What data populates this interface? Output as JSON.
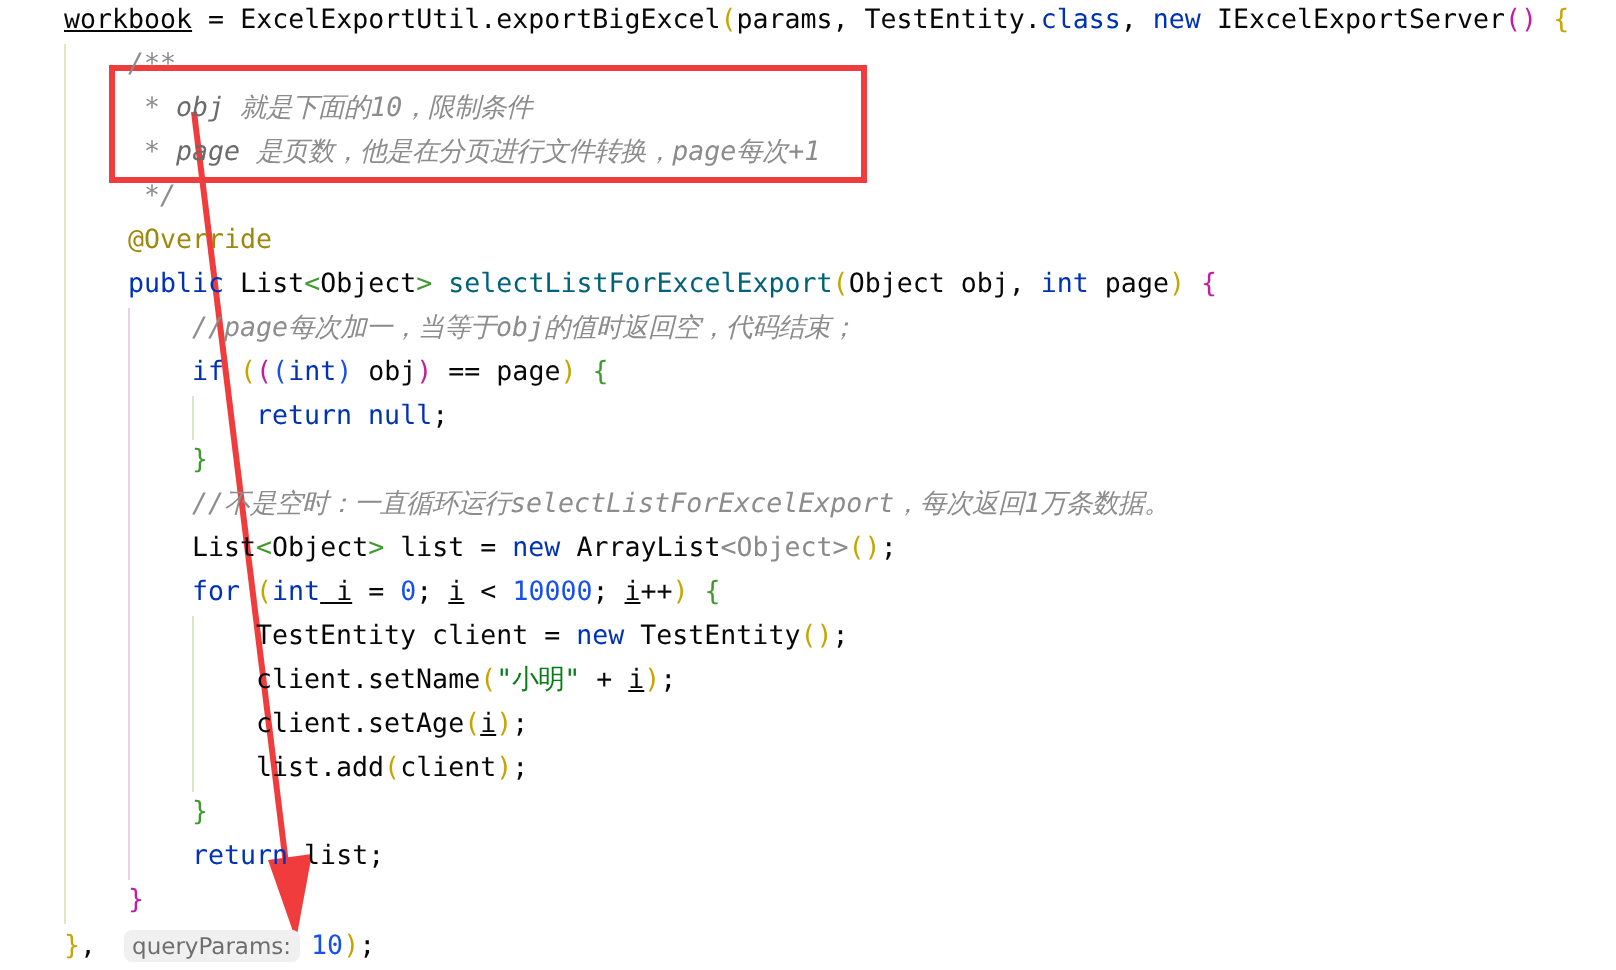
{
  "code_lines": [
    {
      "segments": [
        {
          "text": "workbook",
          "kind": "var"
        },
        {
          "text": " = ExcelExportUtil.exportBigExcel",
          "kind": "plain"
        },
        {
          "text": "(",
          "kind": "yellow"
        },
        {
          "text": "params, TestEntity.",
          "kind": "plain"
        },
        {
          "text": "class",
          "kind": "keyword"
        },
        {
          "text": ", ",
          "kind": "plain"
        },
        {
          "text": "new",
          "kind": "keyword"
        },
        {
          "text": " IExcelExportServer",
          "kind": "plain"
        },
        {
          "text": "()",
          "kind": "magenta"
        },
        {
          "text": " {",
          "kind": "yellow"
        }
      ],
      "children": [
        {
          "segments": [
            {
              "text": "/**",
              "kind": "comment"
            }
          ]
        },
        {
          "segments": [
            {
              "text": " * ",
              "kind": "comment"
            },
            {
              "text": "obj",
              "kind": "docref"
            },
            {
              "text": " 就是下面的10，限制条件",
              "kind": "comment"
            }
          ]
        },
        {
          "segments": [
            {
              "text": " * ",
              "kind": "comment"
            },
            {
              "text": "page",
              "kind": "docref"
            },
            {
              "text": " 是页数，他是在分页进行文件转换，page每次+1",
              "kind": "comment"
            }
          ]
        },
        {
          "segments": [
            {
              "text": " */",
              "kind": "comment"
            }
          ]
        },
        {
          "segments": [
            {
              "text": "@Override",
              "kind": "annotation"
            }
          ]
        },
        {
          "segments": [
            {
              "text": "public",
              "kind": "keyword"
            },
            {
              "text": " List",
              "kind": "plain"
            },
            {
              "text": "<",
              "kind": "green"
            },
            {
              "text": "Object",
              "kind": "plain"
            },
            {
              "text": ">",
              "kind": "green"
            },
            {
              "text": " selectListForExcelExport",
              "kind": "method"
            },
            {
              "text": "(",
              "kind": "yellow"
            },
            {
              "text": "Object obj, ",
              "kind": "plain"
            },
            {
              "text": "int",
              "kind": "keyword"
            },
            {
              "text": " page",
              "kind": "plain"
            },
            {
              "text": ")",
              "kind": "yellow"
            },
            {
              "text": " {",
              "kind": "magenta"
            }
          ],
          "children": [
            {
              "segments": [
                {
                  "text": "//page每次加一，当等于obj的值时返回空，代码结束；",
                  "kind": "comment"
                }
              ]
            },
            {
              "segments": [
                {
                  "text": "if",
                  "kind": "keyword"
                },
                {
                  "text": " (",
                  "kind": "yellow"
                },
                {
                  "text": "(",
                  "kind": "magenta"
                },
                {
                  "text": "(",
                  "kind": "blue"
                },
                {
                  "text": "int",
                  "kind": "keyword"
                },
                {
                  "text": ")",
                  "kind": "blue"
                },
                {
                  "text": " obj",
                  "kind": "plain"
                },
                {
                  "text": ")",
                  "kind": "magenta"
                },
                {
                  "text": " == page",
                  "kind": "plain"
                },
                {
                  "text": ")",
                  "kind": "yellow"
                },
                {
                  "text": " {",
                  "kind": "green"
                }
              ],
              "children": [
                {
                  "segments": [
                    {
                      "text": "return",
                      "kind": "keyword"
                    },
                    {
                      "text": " null",
                      "kind": "keyword"
                    },
                    {
                      "text": ";",
                      "kind": "plain"
                    }
                  ]
                }
              ]
            },
            {
              "segments": [
                {
                  "text": "}",
                  "kind": "green"
                }
              ]
            },
            {
              "segments": [
                {
                  "text": "//不是空时：一直循环运行selectListForExcelExport，每次返回1万条数据。",
                  "kind": "comment"
                }
              ]
            },
            {
              "segments": [
                {
                  "text": "List",
                  "kind": "plain"
                },
                {
                  "text": "<",
                  "kind": "green"
                },
                {
                  "text": "Object",
                  "kind": "plain"
                },
                {
                  "text": ">",
                  "kind": "green"
                },
                {
                  "text": " list = ",
                  "kind": "plain"
                },
                {
                  "text": "new",
                  "kind": "keyword"
                },
                {
                  "text": " ArrayList",
                  "kind": "plain"
                },
                {
                  "text": "<Object>",
                  "kind": "generic"
                },
                {
                  "text": "()",
                  "kind": "yellow"
                },
                {
                  "text": ";",
                  "kind": "plain"
                }
              ]
            },
            {
              "segments": [
                {
                  "text": "for",
                  "kind": "keyword"
                },
                {
                  "text": " (",
                  "kind": "yellow"
                },
                {
                  "text": "int",
                  "kind": "keyword"
                },
                {
                  "text": " i",
                  "kind": "var"
                },
                {
                  "text": " = ",
                  "kind": "plain"
                },
                {
                  "text": "0",
                  "kind": "number"
                },
                {
                  "text": "; ",
                  "kind": "plain"
                },
                {
                  "text": "i",
                  "kind": "var"
                },
                {
                  "text": " < ",
                  "kind": "plain"
                },
                {
                  "text": "10000",
                  "kind": "number"
                },
                {
                  "text": "; ",
                  "kind": "plain"
                },
                {
                  "text": "i",
                  "kind": "var"
                },
                {
                  "text": "++",
                  "kind": "plain"
                },
                {
                  "text": ")",
                  "kind": "yellow"
                },
                {
                  "text": " {",
                  "kind": "green"
                }
              ],
              "children": [
                {
                  "segments": [
                    {
                      "text": "TestEntity client = ",
                      "kind": "plain"
                    },
                    {
                      "text": "new",
                      "kind": "keyword"
                    },
                    {
                      "text": " TestEntity",
                      "kind": "plain"
                    },
                    {
                      "text": "()",
                      "kind": "yellow"
                    },
                    {
                      "text": ";",
                      "kind": "plain"
                    }
                  ]
                },
                {
                  "segments": [
                    {
                      "text": "client.setName",
                      "kind": "plain"
                    },
                    {
                      "text": "(",
                      "kind": "yellow"
                    },
                    {
                      "text": "\"小明\"",
                      "kind": "string"
                    },
                    {
                      "text": " + ",
                      "kind": "plain"
                    },
                    {
                      "text": "i",
                      "kind": "var"
                    },
                    {
                      "text": ")",
                      "kind": "yellow"
                    },
                    {
                      "text": ";",
                      "kind": "plain"
                    }
                  ]
                },
                {
                  "segments": [
                    {
                      "text": "client.setAge",
                      "kind": "plain"
                    },
                    {
                      "text": "(",
                      "kind": "yellow"
                    },
                    {
                      "text": "i",
                      "kind": "var"
                    },
                    {
                      "text": ")",
                      "kind": "yellow"
                    },
                    {
                      "text": ";",
                      "kind": "plain"
                    }
                  ]
                },
                {
                  "segments": [
                    {
                      "text": "list.add",
                      "kind": "plain"
                    },
                    {
                      "text": "(",
                      "kind": "yellow"
                    },
                    {
                      "text": "client",
                      "kind": "plain"
                    },
                    {
                      "text": ")",
                      "kind": "yellow"
                    },
                    {
                      "text": ";",
                      "kind": "plain"
                    }
                  ]
                }
              ]
            },
            {
              "segments": [
                {
                  "text": "}",
                  "kind": "green"
                }
              ]
            },
            {
              "segments": [
                {
                  "text": "return",
                  "kind": "keyword"
                },
                {
                  "text": " list;",
                  "kind": "plain"
                }
              ]
            }
          ]
        },
        {
          "segments": [
            {
              "text": "}",
              "kind": "magenta"
            }
          ]
        }
      ]
    },
    {
      "segments": [
        {
          "text": "}",
          "kind": "yellow"
        },
        {
          "text": ",",
          "kind": "plain"
        },
        {
          "text": "queryParams:",
          "kind": "hint"
        },
        {
          "text": "10",
          "kind": "number"
        },
        {
          "text": ")",
          "kind": "yellow"
        },
        {
          "text": ";",
          "kind": "plain"
        }
      ]
    }
  ]
}
